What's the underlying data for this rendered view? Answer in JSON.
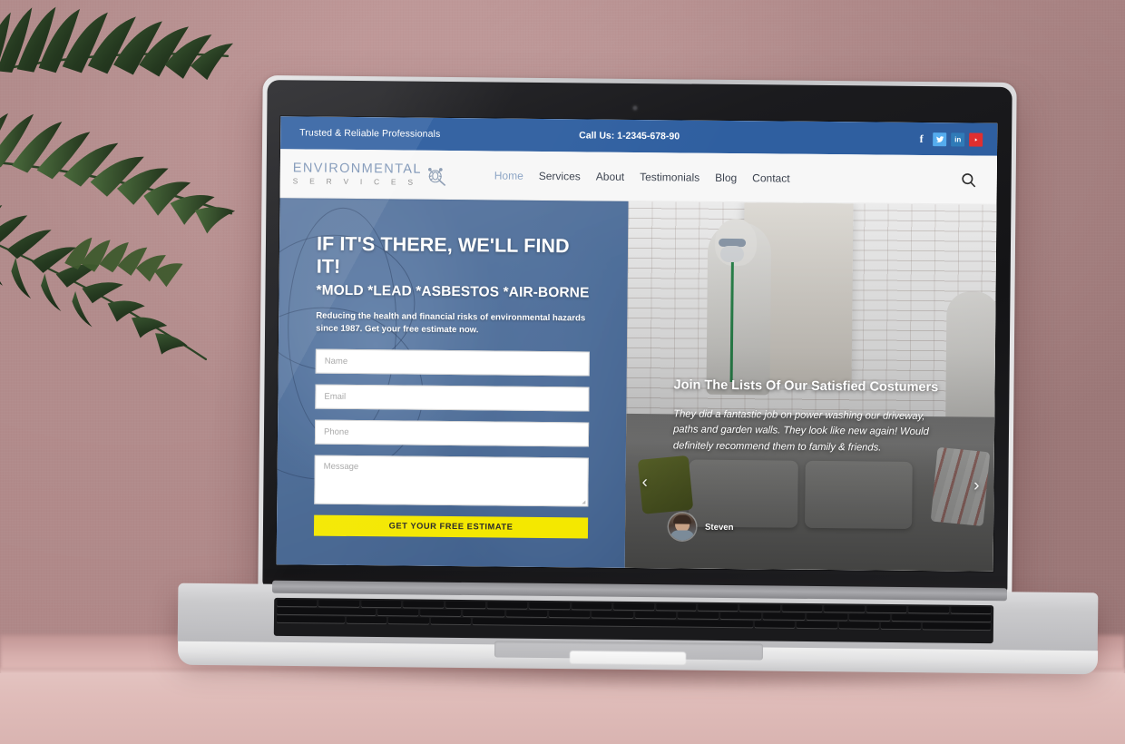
{
  "scene": {
    "device": "macbook-pro-laptop",
    "surface_color": "#e0bab7",
    "wall_color": "#bd9494",
    "plant": "palm-fronds"
  },
  "site": {
    "topbar": {
      "tagline": "Trusted & Reliable Professionals",
      "phone": "Call Us: 1-2345-678-90",
      "bg_color": "#2f5fa0",
      "socials": [
        {
          "name": "facebook",
          "glyph": "f",
          "color": "#2f5fa0"
        },
        {
          "name": "twitter",
          "glyph": "↑",
          "color": "#55acee"
        },
        {
          "name": "linkedin",
          "glyph": "in",
          "color": "#2f7bb8"
        },
        {
          "name": "youtube",
          "glyph": "▶",
          "color": "#e02f2f"
        }
      ]
    },
    "nav": {
      "logo_line1": "ENVIRONMENTAL",
      "logo_line2": "S E R V I C E S",
      "logo_icon": "bug-magnifier-icon",
      "items": [
        {
          "label": "Home",
          "active": true
        },
        {
          "label": "Services",
          "active": false
        },
        {
          "label": "About",
          "active": false
        },
        {
          "label": "Testimonials",
          "active": false
        },
        {
          "label": "Blog",
          "active": false
        },
        {
          "label": "Contact",
          "active": false
        }
      ],
      "search_icon": "search-icon",
      "bg_color": "#f7f7f7",
      "active_color": "#8aa3c4"
    },
    "hero": {
      "heading": "IF IT'S THERE, WE'LL FIND IT!",
      "subheading": "*MOLD *LEAD *ASBESTOS *AIR-BORNE",
      "description": "Reducing the health and financial risks of environmental hazards since 1987. Get your free estimate now.",
      "overlay_color": "#4d6a93",
      "form": {
        "fields": [
          {
            "name": "name",
            "placeholder": "Name",
            "value": "",
            "type": "text"
          },
          {
            "name": "email",
            "placeholder": "Email",
            "value": "",
            "type": "email"
          },
          {
            "name": "phone",
            "placeholder": "Phone",
            "value": "",
            "type": "tel"
          },
          {
            "name": "message",
            "placeholder": "Message",
            "value": "",
            "type": "textarea"
          }
        ],
        "submit_label": "GET YOUR FREE ESTIMATE",
        "submit_color": "#f4e800"
      }
    },
    "testimonial": {
      "heading": "Join The Lists Of Our Satisfied Costumers",
      "quote": "They did a fantastic job on power washing our driveway, paths and garden walls. They look like new again! Would definitely recommend them to family & friends.",
      "author": "Steven",
      "prev_arrow": "‹",
      "next_arrow": "›",
      "background": "hazmat-worker-brick-room-photo"
    }
  }
}
